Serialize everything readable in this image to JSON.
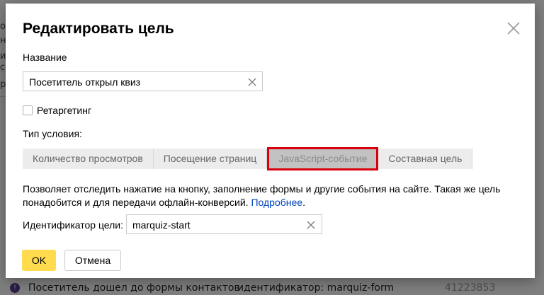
{
  "background": {
    "side_fragments": [
      "о",
      "н",
      "ич",
      "се",
      "р ц"
    ],
    "row": {
      "icon": "!",
      "name": "Посетитель дошел до формы контактов",
      "identifier": "идентификатор: marquiz-form",
      "number": "41223853"
    }
  },
  "modal": {
    "title": "Редактировать цель",
    "name_label": "Название",
    "name_value": "Посетитель открыл квиз",
    "retargeting_label": "Ретаргетинг",
    "condition_type_label": "Тип условия:",
    "tabs": [
      {
        "label": "Количество просмотров"
      },
      {
        "label": "Посещение страниц"
      },
      {
        "label": "JavaScript-событие"
      },
      {
        "label": "Составная цель"
      }
    ],
    "active_tab": "JavaScript-событие",
    "description_line1": "Позволяет отследить нажатие на кнопку, заполнение формы и другие события на сайте. Такая же цель",
    "description_line2": "понадобится и для передачи офлайн-конверсий.",
    "more_link": "Подробнее",
    "id_label": "Идентификатор цели:",
    "id_value": "marquiz-start",
    "ok_label": "OK",
    "cancel_label": "Отмена"
  },
  "colors": {
    "ok_button": "#ffdb4d",
    "highlight_border": "#d8000c",
    "link": "#0044bb"
  },
  "icons": {
    "close": "close-icon",
    "clear": "clear-icon"
  }
}
